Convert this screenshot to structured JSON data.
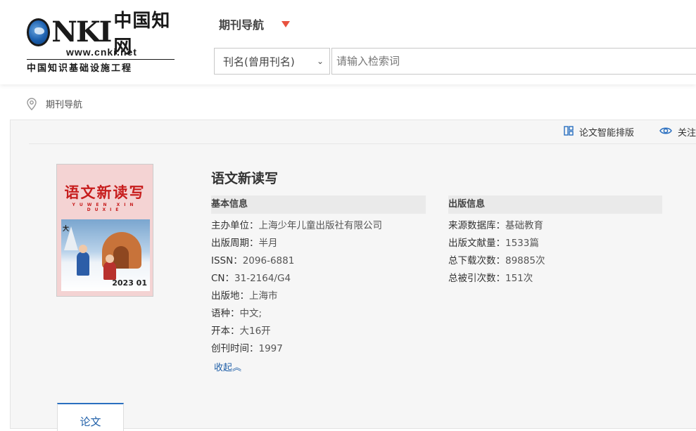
{
  "header": {
    "logo": {
      "brand": "CNKI",
      "brand_cn": "中国知网",
      "url": "www.cnki.net",
      "subtitle": "中国知识基础设施工程"
    },
    "nav_title": "期刊导航",
    "search": {
      "field_selected": "刊名(曾用刊名)",
      "placeholder": "请输入检索词"
    }
  },
  "breadcrumb": {
    "label": "期刊导航"
  },
  "toolbar": {
    "layout_label": "论文智能排版",
    "follow_label": "关注"
  },
  "journal": {
    "title": "语文新读写",
    "cover": {
      "title": "语文新读写",
      "pinyin": "YUWEN XIN DUXIE",
      "issue": "2023 01",
      "tag": "大"
    },
    "basic_info": {
      "heading": "基本信息",
      "rows": [
        {
          "key": "主办单位：",
          "value": "上海少年儿童出版社有限公司"
        },
        {
          "key": "出版周期：",
          "value": "半月"
        },
        {
          "key": "ISSN：",
          "value": "2096-6881"
        },
        {
          "key": "CN：",
          "value": "31-2164/G4"
        },
        {
          "key": "出版地：",
          "value": "上海市"
        },
        {
          "key": "语种：",
          "value": "中文;"
        },
        {
          "key": "开本：",
          "value": "大16开"
        },
        {
          "key": "创刊时间：",
          "value": "1997"
        }
      ],
      "collapse_label": "收起︽"
    },
    "publish_info": {
      "heading": "出版信息",
      "rows": [
        {
          "key": "来源数据库：",
          "value": "基础教育"
        },
        {
          "key": "出版文献量：",
          "value": "1533篇"
        },
        {
          "key": "总下载次数：",
          "value": "89885次"
        },
        {
          "key": "总被引次数：",
          "value": "151次"
        }
      ]
    }
  },
  "tabs": [
    {
      "label": "论文"
    }
  ],
  "colors": {
    "accent": "#2a6fc0",
    "caret": "#e8523f",
    "cover_title": "#c71d1d"
  }
}
